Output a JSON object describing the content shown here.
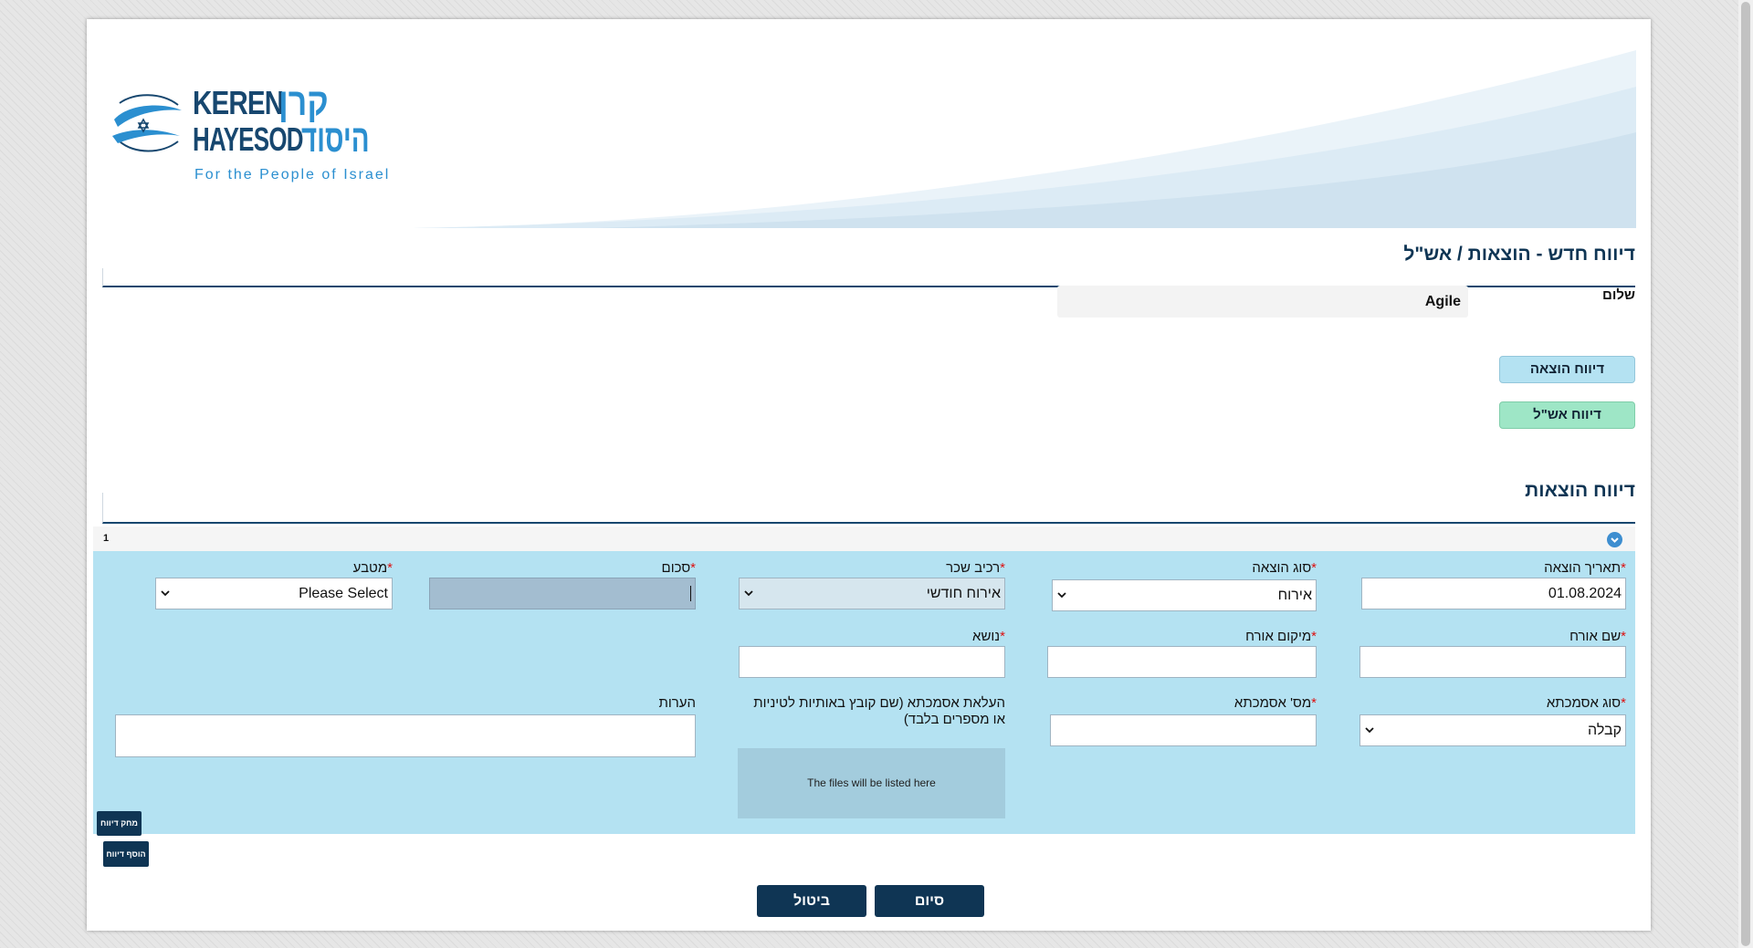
{
  "header": {
    "logo_text": {
      "en_line1": "KEREN",
      "en_line2": "HAYESOD",
      "he_line1": "קרן",
      "he_line2": "היסוד",
      "tagline": "For the People of Israel"
    },
    "page_title": "דיווח חדש - הוצאות / אש\"ל"
  },
  "greeting": {
    "label": "שלום",
    "value": "Agile"
  },
  "actions": {
    "expense_report_label": "דיווח הוצאה",
    "per_diem_report_label": "דיווח אש\"ל"
  },
  "expenses_section": {
    "title": "דיווח הוצאות",
    "report_number": "1",
    "fields": {
      "expense_date": {
        "label": "תאריך הוצאה",
        "value": "01.08.2024"
      },
      "expense_type": {
        "label": "סוג הוצאה",
        "value": "אירוח"
      },
      "salary_component": {
        "label": "רכיב שכר",
        "value": "אירוח חודשי"
      },
      "amount": {
        "label": "סכום",
        "value": ""
      },
      "currency": {
        "label": "מטבע",
        "value": "Please Select"
      },
      "guest_name": {
        "label": "שם אורח",
        "value": ""
      },
      "guest_location": {
        "label": "מיקום אורח",
        "value": ""
      },
      "subject": {
        "label": "נושא",
        "value": ""
      },
      "reference_type": {
        "label": "סוג אסמכתא",
        "value": "קבלה"
      },
      "reference_number": {
        "label": "מס' אסמכתא",
        "value": ""
      },
      "reference_upload": {
        "label": "העלאת אסמכתא (שם קובץ באותיות לטיניות או מספרים בלבד)",
        "placeholder": "The files will be listed here"
      },
      "notes": {
        "label": "הערות",
        "value": ""
      }
    },
    "required_marker": "*",
    "delete_report_label": "מחק דיווח",
    "add_report_label": "הוסף דיווח"
  },
  "footer": {
    "finish_label": "סיום",
    "cancel_label": "ביטול"
  },
  "colors": {
    "brand_navy": "#0f3554",
    "form_bg": "#b4e2f2",
    "expense_btn": "#b4e2f2",
    "per_diem_btn": "#9ee6c6",
    "required": "#d11111"
  }
}
